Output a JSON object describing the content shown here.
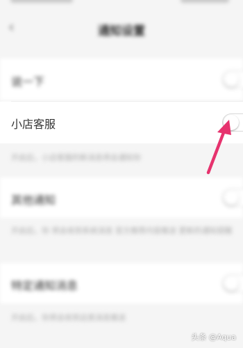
{
  "header": {
    "title": "通知设置",
    "back_icon": "back-arrow-icon"
  },
  "settings": [
    {
      "label": "说一下"
    },
    {
      "label": "小店客服",
      "hint": "开启后，小店客服的新消息将会通知你"
    },
    {
      "label": "其他通知",
      "hint": "开启后，你 将会收到系统消息 官方推荐内容推送 更新的通知提醒"
    },
    {
      "label": "特定通知消息",
      "hint": "开启后，你将会收到这类消息推送"
    }
  ],
  "watermark": "头条 @Aqua",
  "colors": {
    "arrow": "#e6336e",
    "background": "#f5f5f5"
  }
}
